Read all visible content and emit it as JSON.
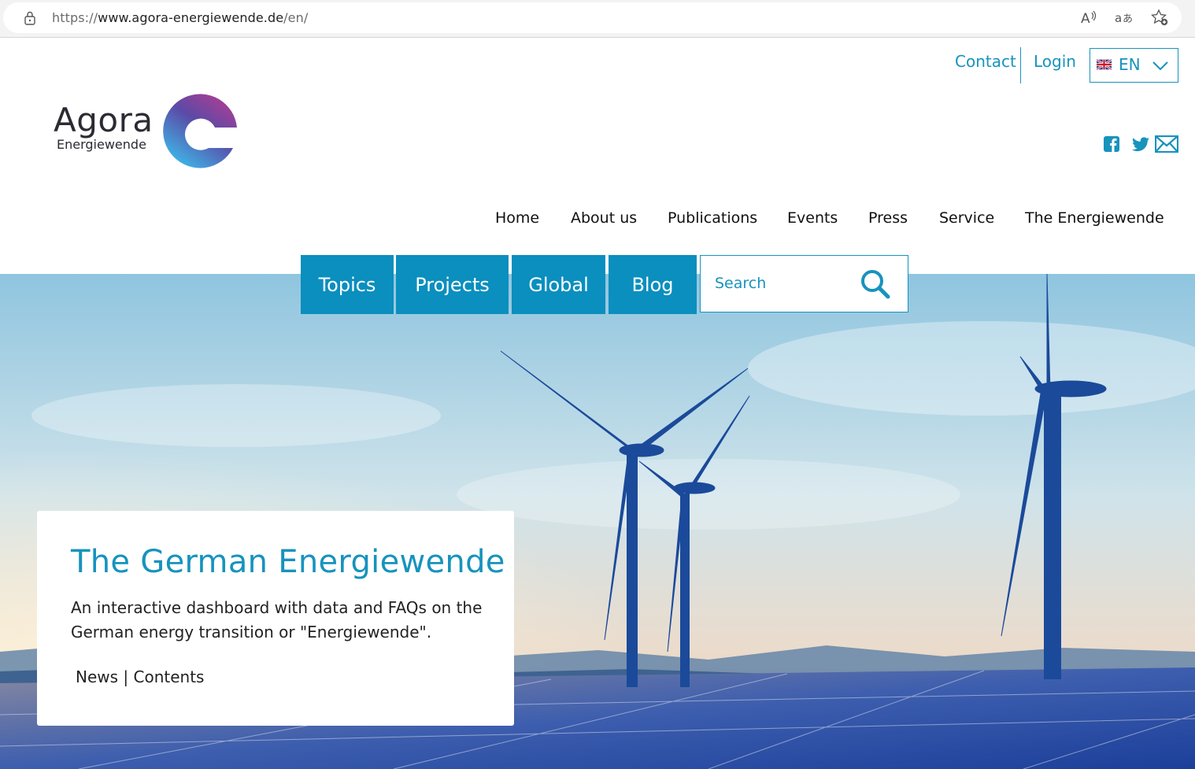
{
  "browser": {
    "url_prefix": "https://",
    "url_host": "www.agora-energiewende.de",
    "url_path": "/en/"
  },
  "header": {
    "contact": "Contact",
    "login": "Login",
    "language": "EN"
  },
  "logo": {
    "word": "Agora",
    "sub": "Energiewende"
  },
  "nav": [
    "Home",
    "About us",
    "Publications",
    "Events",
    "Press",
    "Service",
    "The Energiewende"
  ],
  "tabs": [
    "Topics",
    "Projects",
    "Global",
    "Blog"
  ],
  "search": {
    "placeholder": "Search"
  },
  "hero_card": {
    "title": "The German Energiewende",
    "text": "An interactive dashboard with data and FAQs on the German energy transition or \"Energiewende\".",
    "link_news": "News",
    "separator": "|",
    "link_contents": "Contents"
  },
  "colors": {
    "accent": "#1793bd",
    "tab_bg": "#0a8fbf"
  }
}
